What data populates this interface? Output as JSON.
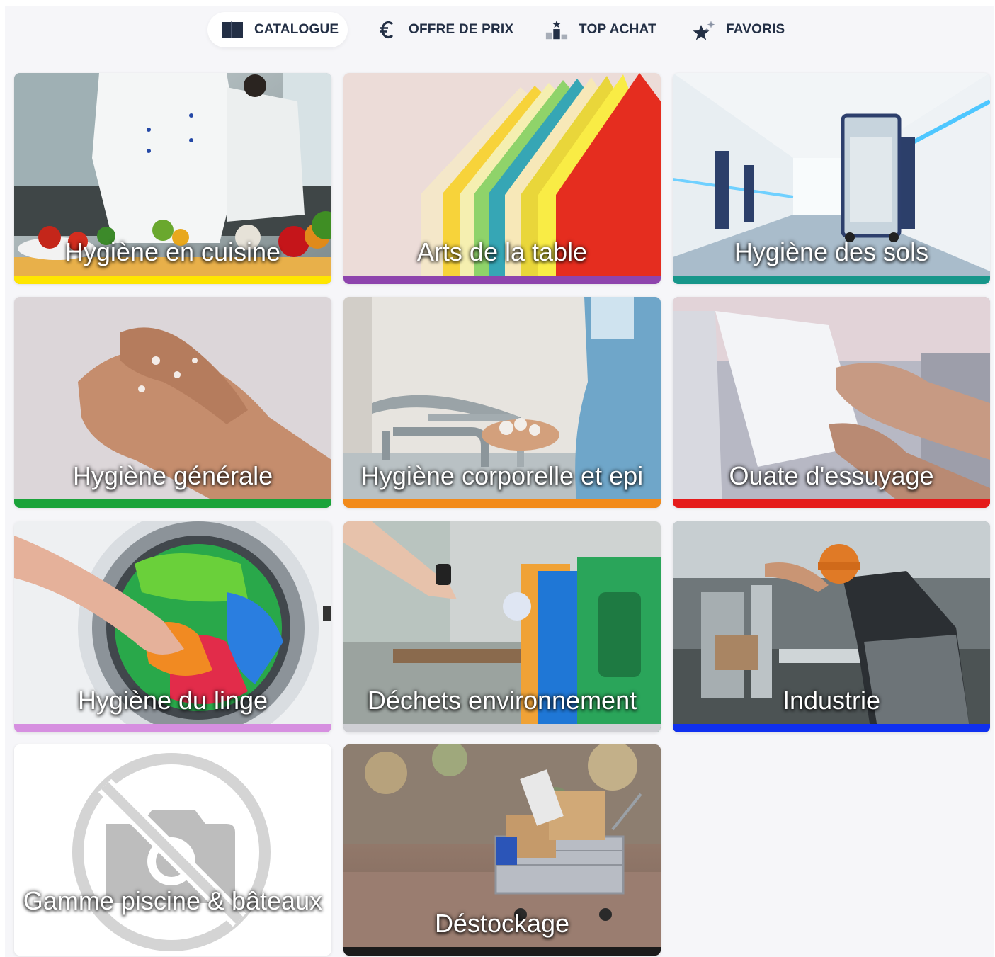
{
  "nav": {
    "tabs": [
      {
        "label": "CATALOGUE",
        "icon": "book-icon",
        "active": true
      },
      {
        "label": "OFFRE DE PRIX",
        "icon": "euro-icon",
        "active": false
      },
      {
        "label": "TOP ACHAT",
        "icon": "podium-icon",
        "active": false
      },
      {
        "label": "FAVORIS",
        "icon": "sparkle-star-icon",
        "active": false
      }
    ]
  },
  "categories": [
    {
      "label": "Hygiène en cuisine",
      "color": "#ffe600",
      "photo": "kitchen-chef-photo"
    },
    {
      "label": "Arts de la table",
      "color": "#8e44ad",
      "photo": "colored-napkins-photo"
    },
    {
      "label": "Hygiène des sols",
      "color": "#17968a",
      "photo": "hospital-corridor-photo"
    },
    {
      "label": "Hygiène générale",
      "color": "#1aa33a",
      "photo": "hand-washing-photo"
    },
    {
      "label": "Hygiène corporelle et epi",
      "color": "#f28a1a",
      "photo": "surgical-hand-washing-photo"
    },
    {
      "label": "Ouate d'essuyage",
      "color": "#e51b1b",
      "photo": "paper-towel-photo"
    },
    {
      "label": "Hygiène du linge",
      "color": "#d68fe0",
      "photo": "washing-machine-photo"
    },
    {
      "label": "Déchets environnement",
      "color": "#cfcfd4",
      "photo": "recycling-bins-photo"
    },
    {
      "label": "Industrie",
      "color": "#1030f0",
      "photo": "factory-worker-photo"
    },
    {
      "label": "Gamme piscine & bâteaux",
      "color": "#ffffff",
      "photo": "no-photo-placeholder-icon"
    },
    {
      "label": "Déstockage",
      "color": "#1b1b1b",
      "photo": "shopping-cart-boxes-photo"
    }
  ]
}
